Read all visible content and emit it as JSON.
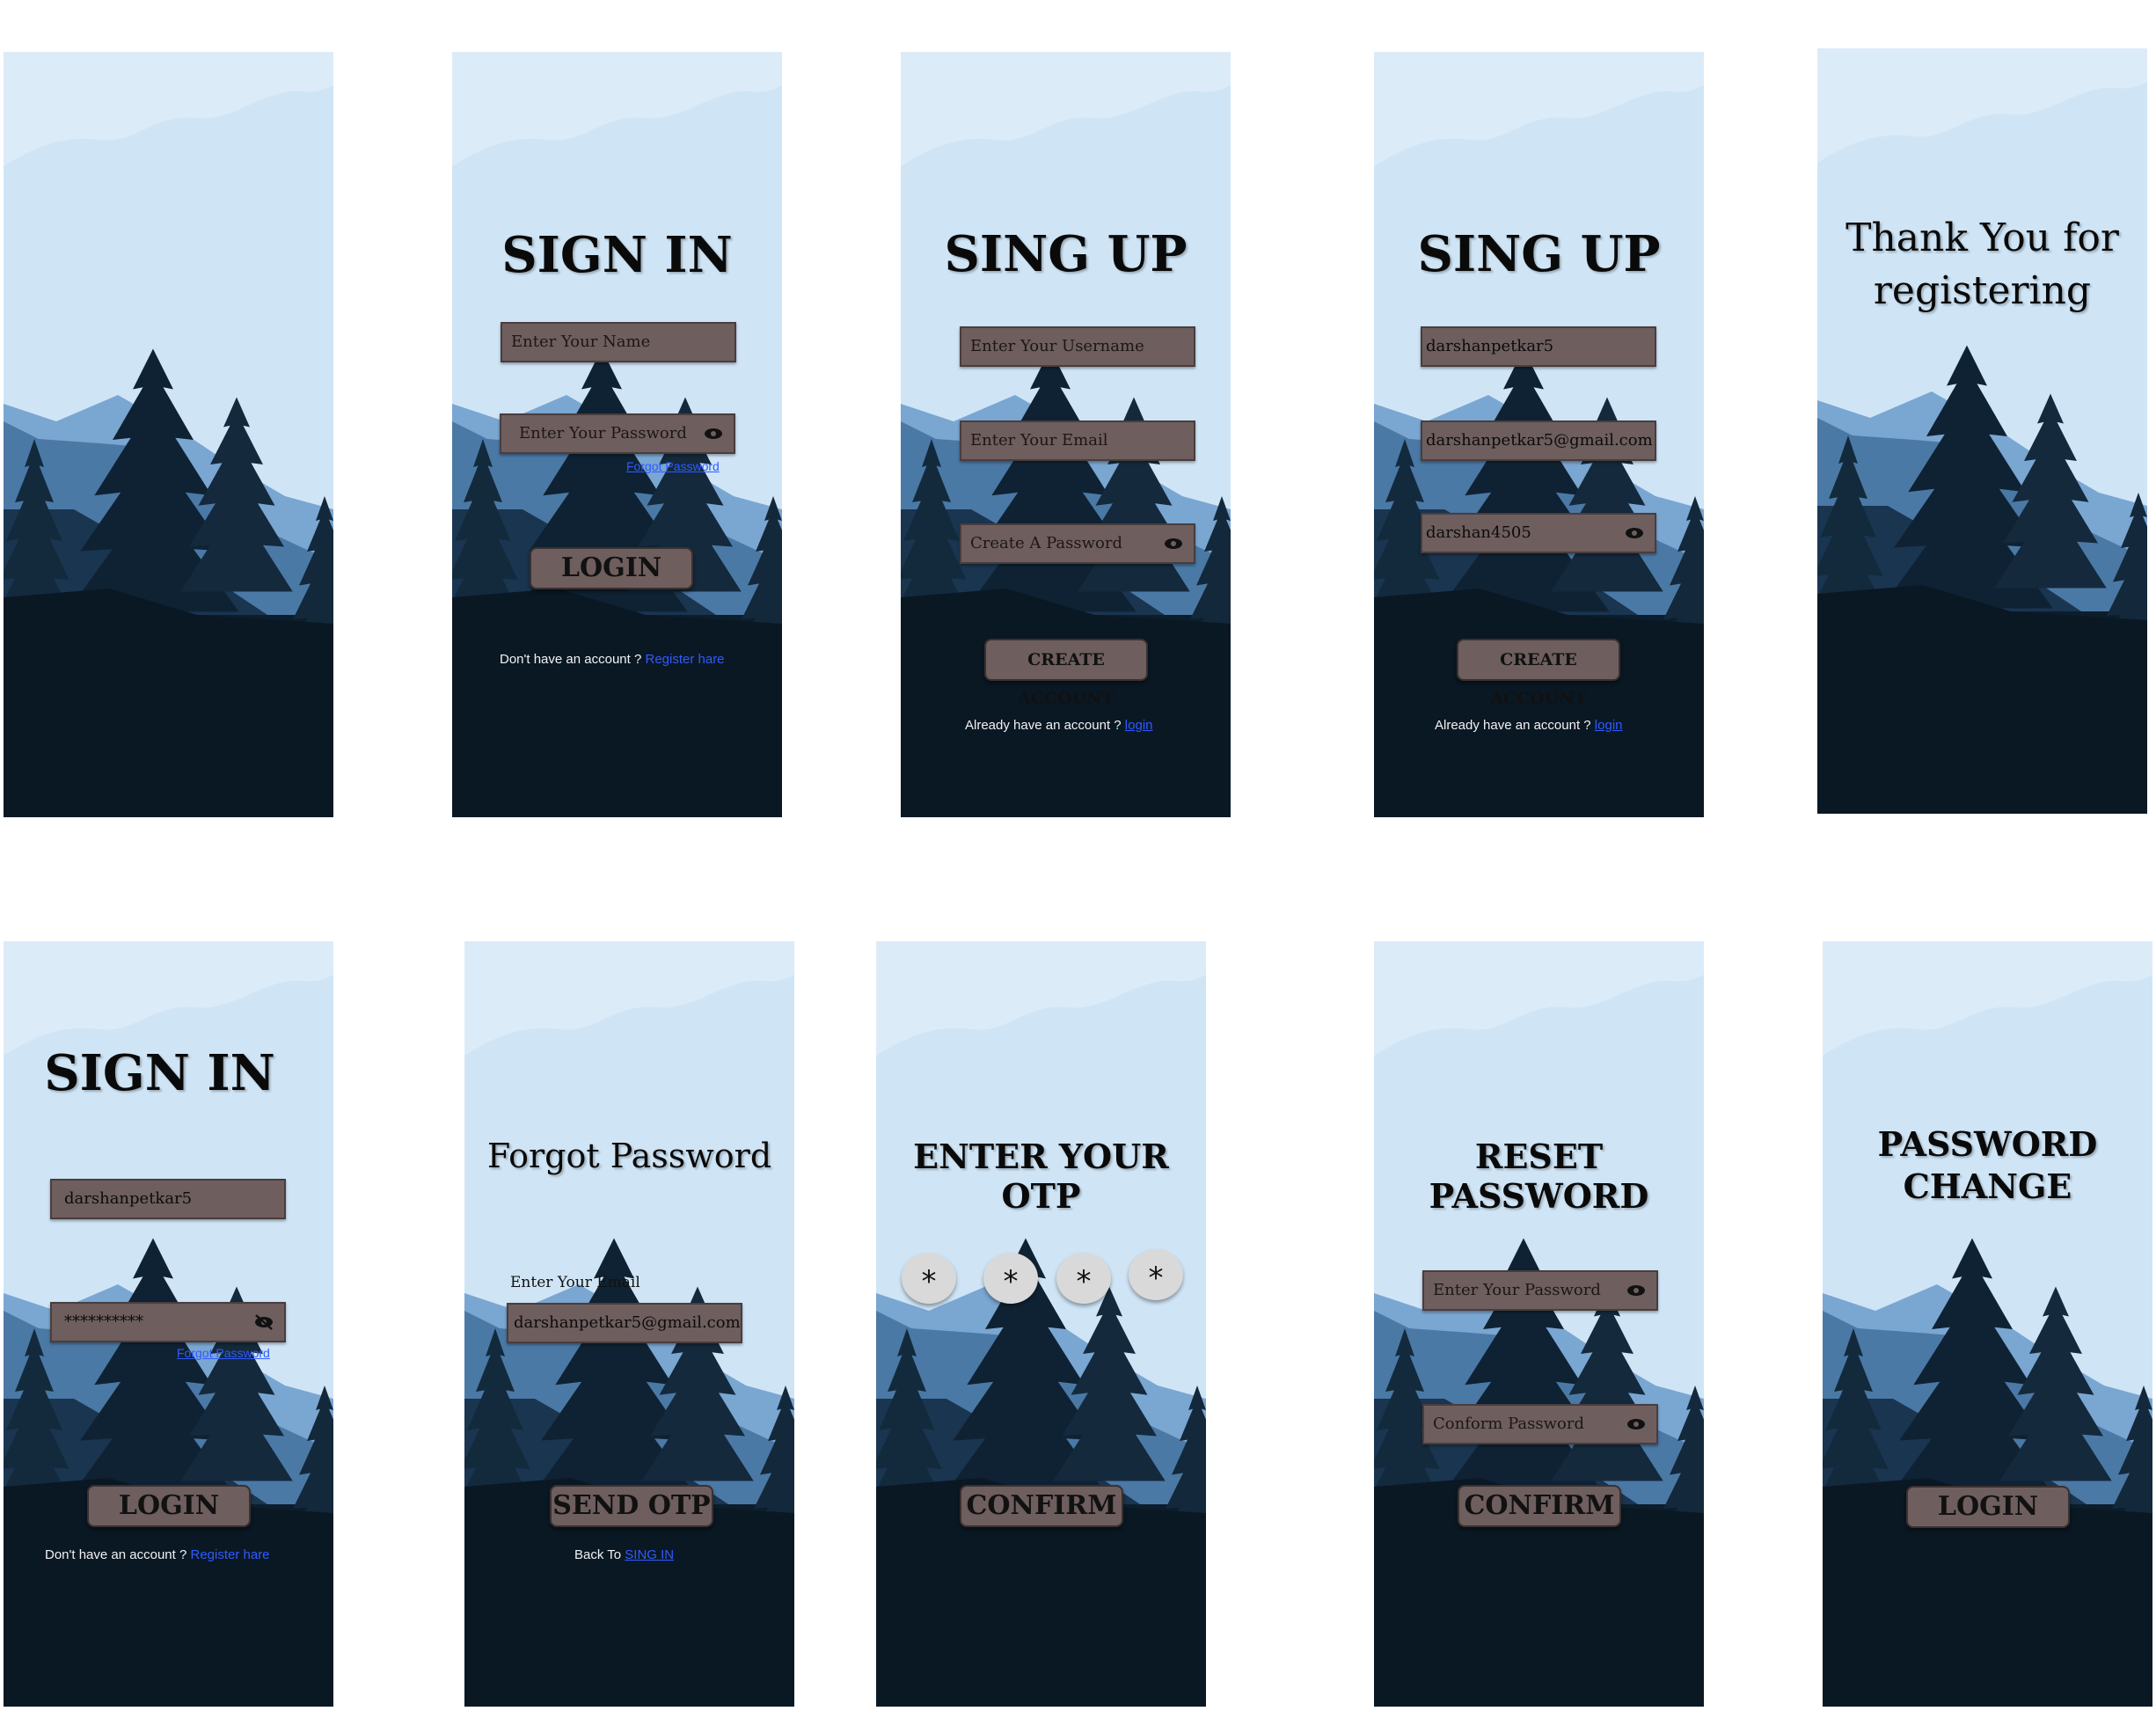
{
  "screens": [
    {
      "id": "splash"
    },
    {
      "id": "sign-in",
      "title": "SIGN IN",
      "name_placeholder": "Enter Your Name",
      "password_placeholder": "Enter Your Password",
      "forgot": "Forgot Password",
      "button": "LOGIN",
      "footer_text": "Don't have an account ?",
      "footer_link": "Register hare"
    },
    {
      "id": "sign-up-empty",
      "title": "SING UP",
      "username_placeholder": "Enter Your Username",
      "email_placeholder": "Enter Your Email",
      "password_placeholder": "Create A Password",
      "button": "CREATE ACCOUNT",
      "footer_text": "Already have an account ?",
      "footer_link": "login"
    },
    {
      "id": "sign-up-filled",
      "title": "SING UP",
      "username_value": "darshanpetkar5",
      "email_value": "darshanpetkar5@gmail.com",
      "password_value": "darshan4505",
      "button": "CREATE ACCOUNT",
      "footer_text": "Already have an account ?",
      "footer_link": "login"
    },
    {
      "id": "thank-you",
      "title_line1": "Thank You for",
      "title_line2": "registering"
    },
    {
      "id": "sign-in-filled",
      "title": "SIGN IN",
      "name_value": "darshanpetkar5",
      "password_value": "**********",
      "forgot": "Forgot Password",
      "button": "LOGIN",
      "footer_text": "Don't have an account ?",
      "footer_link": "Register hare"
    },
    {
      "id": "forgot-password",
      "title": "Forgot Password",
      "email_label": "Enter Your Email",
      "email_value": "darshanpetkar5@gmail.com",
      "button": "SEND OTP",
      "footer_text": "Back To",
      "footer_link": "SING IN"
    },
    {
      "id": "enter-otp",
      "title": "ENTER YOUR OTP",
      "otp_digits": [
        "*",
        "*",
        "*",
        "*"
      ],
      "button": "CONFIRM"
    },
    {
      "id": "reset-password",
      "title": "RESET PASSWORD",
      "password_placeholder": "Enter Your Password",
      "confirm_placeholder": "Conform Password",
      "button": "CONFIRM"
    },
    {
      "id": "password-changed",
      "title_line1": "PASSWORD",
      "title_line2": "CHANGE",
      "button": "LOGIN"
    }
  ],
  "colors": {
    "sky_light": "#dcebf8",
    "sky": "#cfe5f6",
    "mountain_mid": "#6f9ccb",
    "mountain_dark": "#3f6f9c",
    "forest": "#0d1d2b",
    "ground": "#05111b",
    "field_bg": "#6e5e5e",
    "link": "#2f5bff"
  }
}
